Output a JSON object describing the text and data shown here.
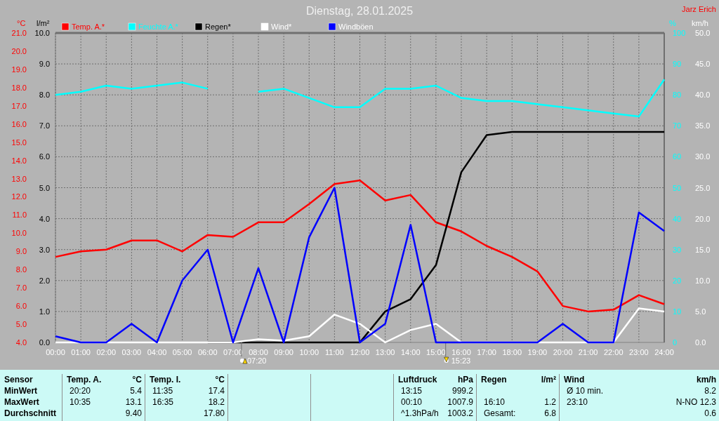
{
  "title": "Dienstag, 28.01.2025",
  "station": "Jarz Erich",
  "left_chart": {
    "chart_data": {
      "type": "line",
      "legend": "top",
      "grid": true,
      "x": [
        0,
        1,
        2,
        3,
        4,
        5,
        6,
        7,
        8,
        9,
        10,
        11,
        12,
        13,
        14,
        15,
        16,
        17,
        18,
        19,
        20,
        21,
        22,
        23,
        24
      ],
      "xlim": [
        0,
        24
      ],
      "xticks": [
        {
          "value": 0,
          "label": "00:00"
        },
        {
          "value": 1,
          "label": "01:00"
        },
        {
          "value": 2,
          "label": "02:00"
        },
        {
          "value": 3,
          "label": "03:00"
        },
        {
          "value": 4,
          "label": "04:00"
        },
        {
          "value": 5,
          "label": "05:00"
        },
        {
          "value": 6,
          "label": "06:00"
        },
        {
          "value": 7,
          "label": "07:00"
        },
        {
          "value": 8,
          "label": "08:00"
        },
        {
          "value": 9,
          "label": "09:00"
        },
        {
          "value": 10,
          "label": "10:00"
        },
        {
          "value": 11,
          "label": "11:00"
        },
        {
          "value": 12,
          "label": "12:00"
        },
        {
          "value": 13,
          "label": "13:00"
        },
        {
          "value": 14,
          "label": "14:00"
        },
        {
          "value": 15,
          "label": "15:00"
        },
        {
          "value": 16,
          "label": "16:00"
        },
        {
          "value": 17,
          "label": "17:00"
        },
        {
          "value": 18,
          "label": "18:00"
        },
        {
          "value": 19,
          "label": "19:00"
        },
        {
          "value": 20,
          "label": "20:00"
        },
        {
          "value": 21,
          "label": "21:00"
        },
        {
          "value": 22,
          "label": "22:00"
        },
        {
          "value": 23,
          "label": "23:00"
        },
        {
          "value": 24,
          "label": "24:00"
        }
      ],
      "ylabel": "°C",
      "ylim": [
        4,
        21
      ],
      "yticks": [
        {
          "value": 21,
          "label": "21.0"
        },
        {
          "value": 20,
          "label": "20.0"
        },
        {
          "value": 19,
          "label": "19.0"
        },
        {
          "value": 18,
          "label": "18.0"
        },
        {
          "value": 17,
          "label": "17.0"
        },
        {
          "value": 16,
          "label": "16.0"
        },
        {
          "value": 15,
          "label": "15.0"
        },
        {
          "value": 14,
          "label": "14.0"
        },
        {
          "value": 13,
          "label": "13.0"
        },
        {
          "value": 12,
          "label": "12.0"
        },
        {
          "value": 11,
          "label": "11.0"
        },
        {
          "value": 10,
          "label": "10.0"
        },
        {
          "value": 9,
          "label": "9.0"
        },
        {
          "value": 8,
          "label": "8.0"
        },
        {
          "value": 7,
          "label": "7.0"
        },
        {
          "value": 6,
          "label": "6.0"
        },
        {
          "value": 5,
          "label": "5.0"
        },
        {
          "value": 4,
          "label": "4.0"
        }
      ],
      "y2label": "l/m²",
      "y2lim": [
        0,
        10
      ],
      "y2ticks": [
        {
          "value": 10,
          "label": "10.0"
        },
        {
          "value": 9,
          "label": "9.0"
        },
        {
          "value": 8,
          "label": "8.0"
        },
        {
          "value": 7,
          "label": "7.0"
        },
        {
          "value": 6,
          "label": "6.0"
        },
        {
          "value": 5,
          "label": "5.0"
        },
        {
          "value": 4,
          "label": "4.0"
        },
        {
          "value": 3,
          "label": "3.0"
        },
        {
          "value": 2,
          "label": "2.0"
        },
        {
          "value": 1,
          "label": "1.0"
        },
        {
          "value": 0,
          "label": "0.0"
        }
      ],
      "series": [
        {
          "name": "Temp. A.*",
          "color": "#ff0000",
          "values": [
            8.7,
            9.0,
            9.1,
            9.6,
            9.6,
            9.0,
            9.9,
            9.8,
            10.6,
            10.6,
            11.6,
            12.7,
            12.9,
            11.8,
            12.1,
            10.6,
            10.1,
            9.3,
            8.7,
            7.9,
            6.0,
            5.7,
            5.8,
            6.6,
            6.1
          ]
        },
        {
          "name": "Regen*",
          "color": "#000000",
          "axis": "y2",
          "values": [
            null,
            null,
            null,
            null,
            null,
            null,
            0,
            0,
            0,
            0,
            0,
            0,
            0,
            1.0,
            1.4,
            2.5,
            5.5,
            6.7,
            6.8,
            6.8,
            6.8,
            6.8,
            6.8,
            6.8,
            6.8
          ]
        }
      ],
      "annotations": [
        "07:20",
        "15:23"
      ]
    }
  },
  "right_chart": {
    "chart_data": {
      "type": "line",
      "legend": "top",
      "x": [
        0,
        1,
        2,
        3,
        4,
        5,
        6,
        7,
        8,
        9,
        10,
        11,
        12,
        13,
        14,
        15,
        16,
        17,
        18,
        19,
        20,
        21,
        22,
        23,
        24
      ],
      "xlim": [
        0,
        24
      ],
      "ylabel": "%",
      "ylim": [
        0,
        100
      ],
      "yticks": [
        {
          "value": 100,
          "label": "100"
        },
        {
          "value": 90,
          "label": "90"
        },
        {
          "value": 80,
          "label": "80"
        },
        {
          "value": 70,
          "label": "70"
        },
        {
          "value": 60,
          "label": "60"
        },
        {
          "value": 50,
          "label": "50"
        },
        {
          "value": 40,
          "label": "40"
        },
        {
          "value": 30,
          "label": "30"
        },
        {
          "value": 20,
          "label": "20"
        },
        {
          "value": 10,
          "label": "10"
        },
        {
          "value": 0,
          "label": "0"
        }
      ],
      "y2label": "km/h",
      "y2lim": [
        0,
        50
      ],
      "y2ticks": [
        {
          "value": 50,
          "label": "50.0"
        },
        {
          "value": 45,
          "label": "45.0"
        },
        {
          "value": 40,
          "label": "40.0"
        },
        {
          "value": 35,
          "label": "35.0"
        },
        {
          "value": 30,
          "label": "30.0"
        },
        {
          "value": 25,
          "label": "25.0"
        },
        {
          "value": 20,
          "label": "20.0"
        },
        {
          "value": 15,
          "label": "15.0"
        },
        {
          "value": 10,
          "label": "10.0"
        },
        {
          "value": 5,
          "label": "5.0"
        },
        {
          "value": 0,
          "label": "0.0"
        }
      ],
      "series": [
        {
          "name": "Feuchte A.*",
          "color": "#00ffff",
          "values": [
            80,
            81,
            83,
            82,
            83,
            84,
            82,
            null,
            81,
            82,
            79,
            76,
            76,
            82,
            82,
            83,
            79,
            78,
            78,
            77,
            76,
            75,
            74,
            73,
            85
          ]
        },
        {
          "name": "Wind*",
          "color": "#ffffff",
          "axis": "y2",
          "values": [
            0,
            0,
            0,
            0,
            0,
            0,
            0,
            0,
            0.5,
            0.3,
            1,
            4.5,
            3,
            0,
            2,
            3,
            0,
            0,
            0,
            0,
            0,
            0,
            0,
            5.5,
            5
          ]
        },
        {
          "name": "Windböen",
          "color": "#0000ff",
          "axis": "y2",
          "values": [
            1,
            0,
            0,
            3,
            0,
            10,
            15,
            0,
            12,
            0,
            17,
            25,
            0,
            3,
            19,
            0,
            0,
            0,
            0,
            0,
            3,
            0,
            0,
            21,
            18
          ]
        }
      ]
    }
  },
  "stats": {
    "columns": [
      {
        "kind": "label",
        "header": "Sensor",
        "rows": [
          {
            "value": "MinWert"
          },
          {
            "value": "MaxWert"
          },
          {
            "value": "Durchschnitt"
          }
        ]
      },
      {
        "kind": "data",
        "header": "Temp. A.",
        "unit": "°C",
        "rows": [
          {
            "time": "20:20",
            "value": "5.4"
          },
          {
            "time": "10:35",
            "value": "13.1"
          },
          {
            "value": "9.40"
          }
        ]
      },
      {
        "kind": "data",
        "header": "Temp. I.",
        "unit": "°C",
        "rows": [
          {
            "time": "11:35",
            "value": "17.4"
          },
          {
            "time": "16:35",
            "value": "18.2"
          },
          {
            "value": "17.80"
          }
        ]
      },
      {
        "kind": "blank"
      },
      {
        "kind": "blank"
      },
      {
        "kind": "data",
        "header": "Luftdruck",
        "unit": "hPa",
        "rows": [
          {
            "time": "13:15",
            "value": "999.2"
          },
          {
            "time": "00:10",
            "value": "1007.9"
          },
          {
            "time": "^1.3hPa/h",
            "value": "1003.2"
          }
        ]
      },
      {
        "kind": "data",
        "header": "Regen",
        "unit": "l/m²",
        "rows": [
          {},
          {
            "time": "16:10",
            "value": "1.2"
          },
          {
            "time": "Gesamt:",
            "value": "6.8"
          }
        ]
      },
      {
        "kind": "data",
        "header": "Wind",
        "unit": "km/h",
        "rows": [
          {
            "time": "Ø 10 min.",
            "value": "8.2"
          },
          {
            "time": "23:10",
            "value": "N-NO 12.3"
          },
          {
            "value": "0.6"
          }
        ]
      }
    ]
  }
}
